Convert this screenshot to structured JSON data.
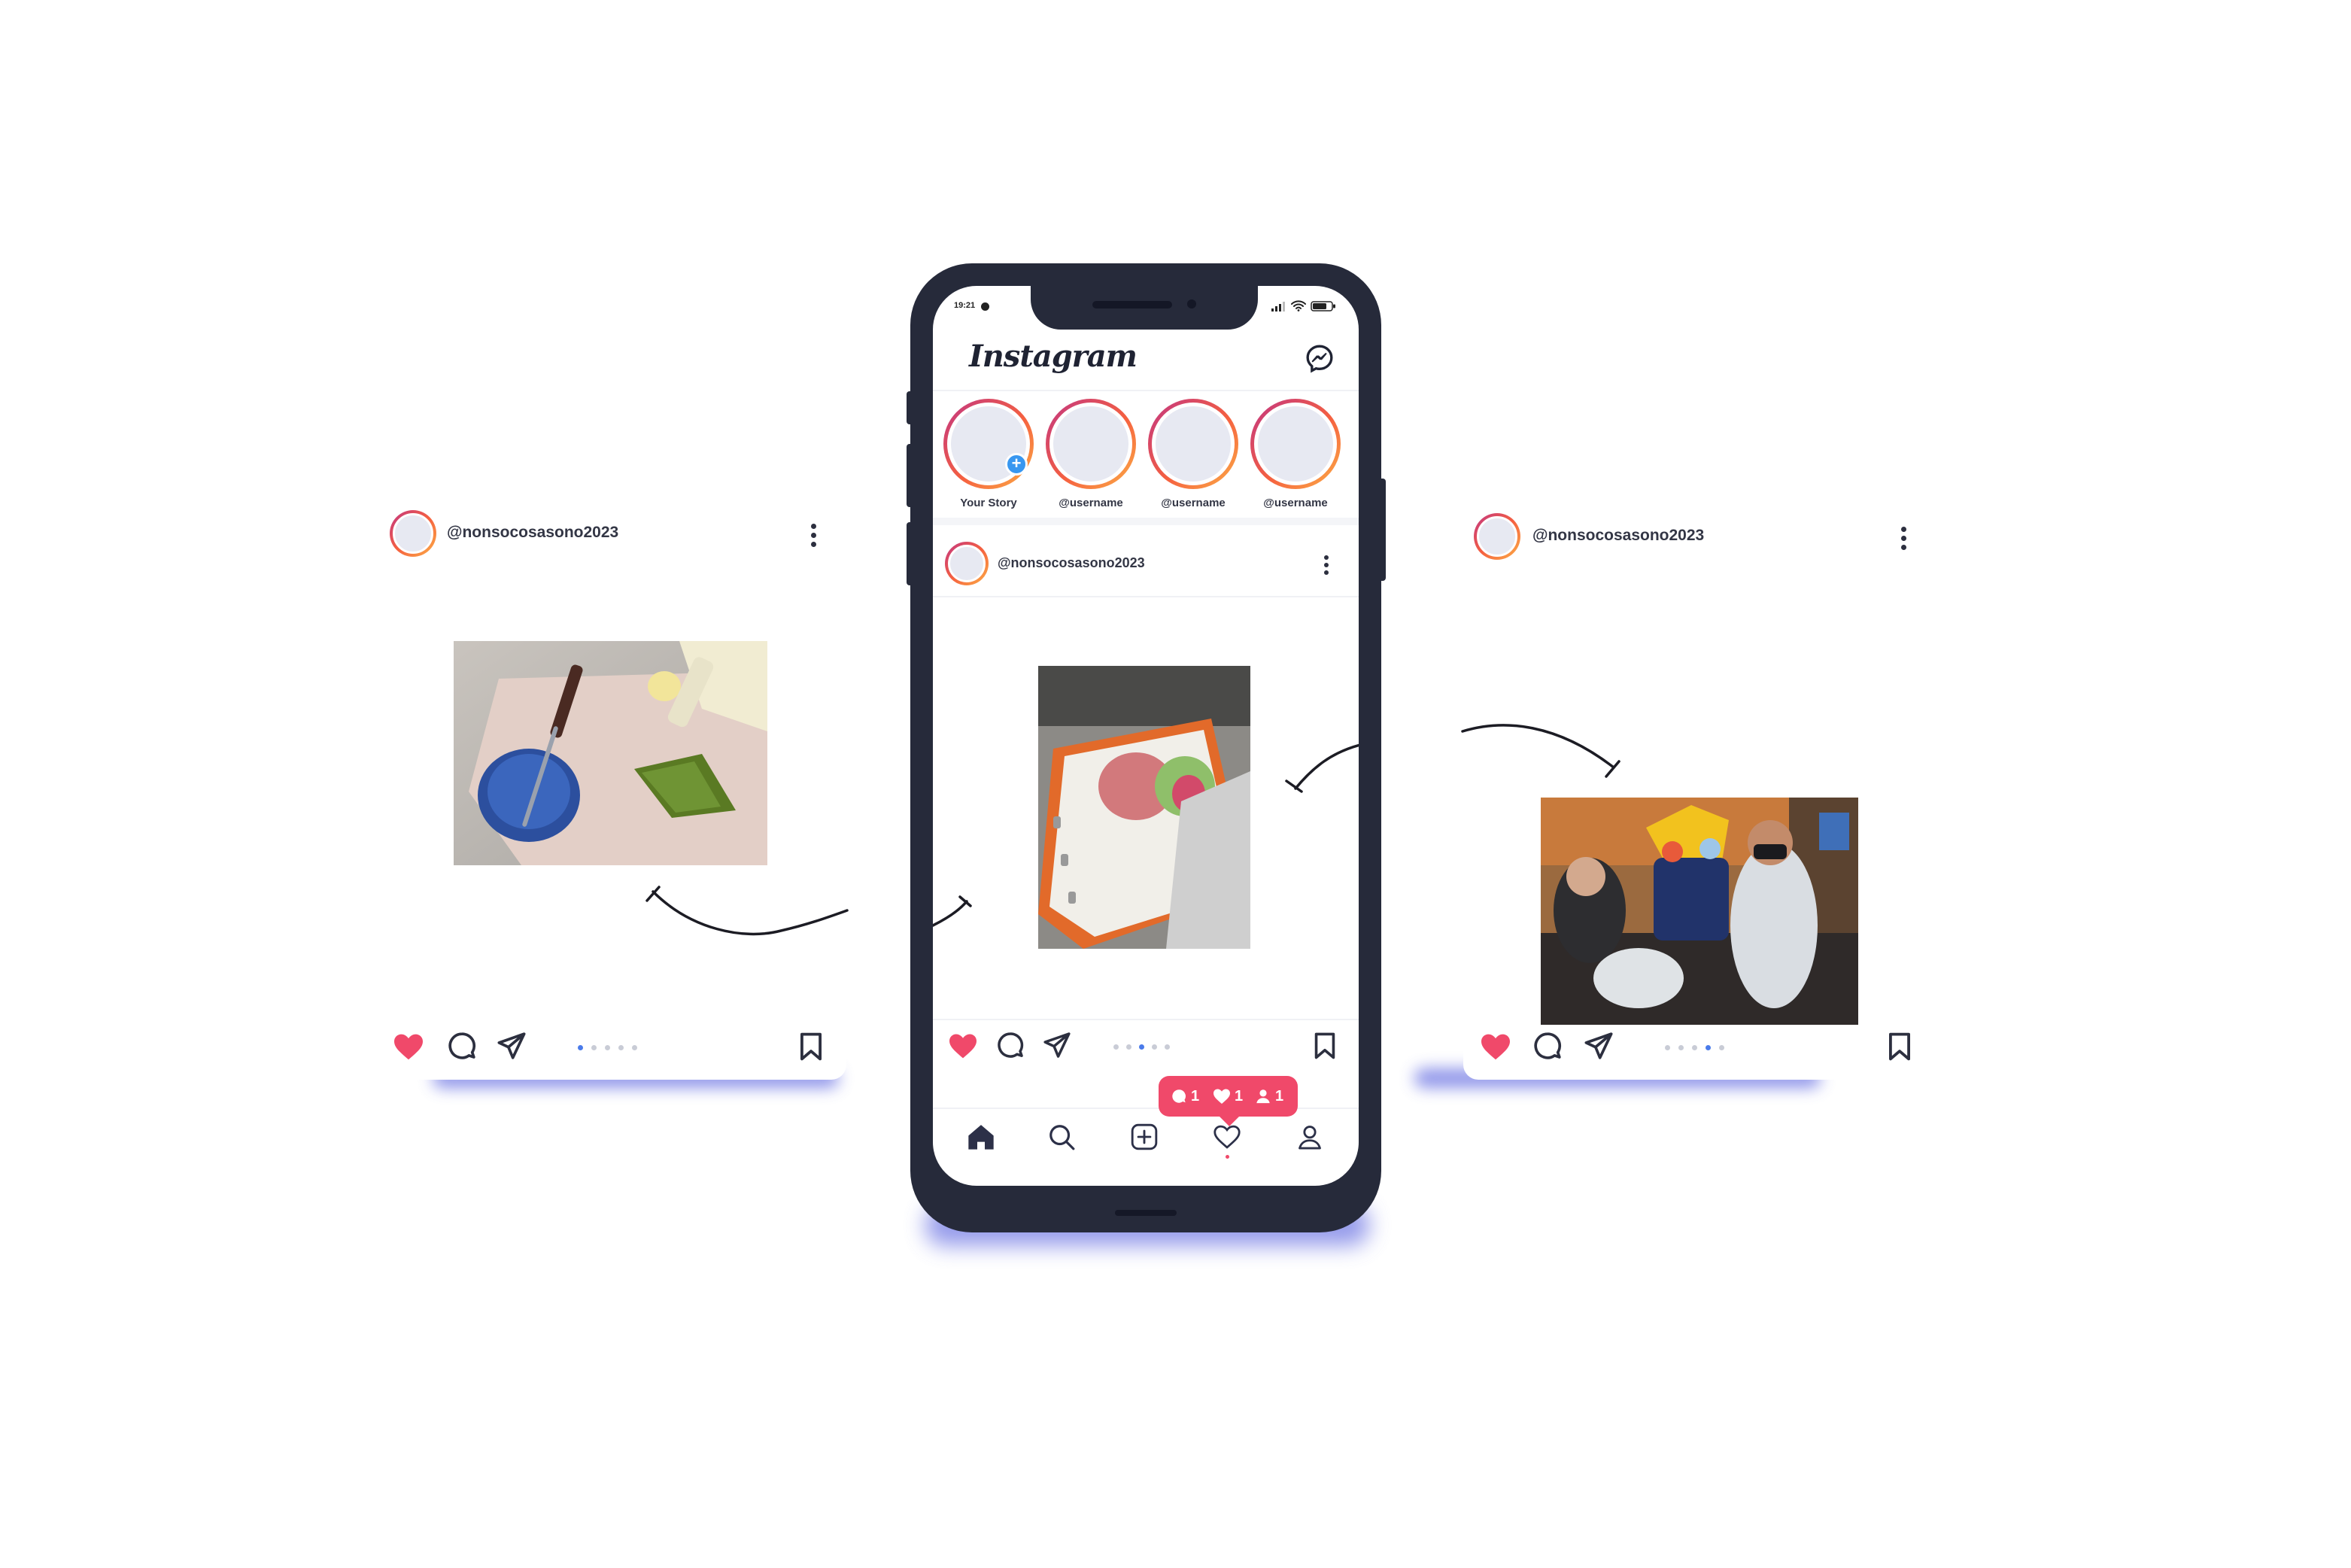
{
  "status_bar": {
    "time": "19:21"
  },
  "app": {
    "logo_text": "Instagram"
  },
  "stories": [
    {
      "label": "Your Story"
    },
    {
      "label": "@username"
    },
    {
      "label": "@username"
    },
    {
      "label": "@username"
    }
  ],
  "posts": {
    "left": {
      "username": "@nonsocosasono2023",
      "carousel_total": 5,
      "carousel_active": 1,
      "photo_desc_icon": "photo"
    },
    "center": {
      "username": "@nonsocosasono2023",
      "carousel_total": 5,
      "carousel_active": 3
    },
    "right": {
      "username": "@nonsocosasono2023",
      "carousel_total": 5,
      "carousel_active": 4
    }
  },
  "notification": {
    "comments": "1",
    "likes": "1",
    "follows": "1"
  },
  "colors": {
    "accent_like": "#f0496a",
    "phone_body": "#262a3a",
    "shadow": "#7c83e6",
    "active_dot": "#4a7bea"
  }
}
